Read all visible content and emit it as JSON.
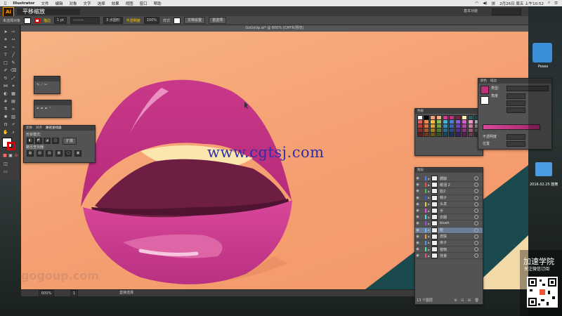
{
  "menubar": {
    "app_name": "Illustrator",
    "items": [
      "文件",
      "编辑",
      "对象",
      "文字",
      "选择",
      "效果",
      "视图",
      "窗口",
      "帮助"
    ],
    "datetime": "2月26日 周五 上午10:52"
  },
  "appbar": {
    "logo": "Ai",
    "workspace": "基本功能",
    "overlay_text": "平移缩放"
  },
  "control_bar": {
    "selection_label": "未选择对象",
    "stroke_label": "描边",
    "stroke_weight": "1 pt",
    "brush_label": "3 点圆形",
    "opacity_label": "不透明度",
    "opacity_value": "100%",
    "style_label": "样式",
    "doc_setup_button": "文档设置",
    "prefs_button": "首选项"
  },
  "document": {
    "tab_title": "GoGoUp.ai* @ 600% (CMYK/预览)"
  },
  "canvas": {
    "watermark": "www.cgtsj.com",
    "brand_watermark": "gogoup.com"
  },
  "status_bar": {
    "zoom": "600%",
    "page": "1",
    "tool_name": "直接选择"
  },
  "pathfinder_panel": {
    "tabs": [
      "变换",
      "对齐",
      "路径查找器"
    ],
    "shape_modes_label": "形状模式:",
    "expand_button": "扩展",
    "pathfinders_label": "路径查找器:"
  },
  "swatches_panel": {
    "title": "色板",
    "colors": [
      [
        "#ffffff",
        "#000000",
        "#f5a072",
        "#f7b384",
        "#d63a8e",
        "#c2307c",
        "#7a1f45",
        "#fff1b5",
        "#2d5b5e",
        "#1d4a4d"
      ],
      [
        "#e85a5a",
        "#f08a4b",
        "#f5c244",
        "#8cc152",
        "#48b0d8",
        "#4a7fd1",
        "#8a5ed6",
        "#d65ec5",
        "#e89cc0",
        "#b0b0b0"
      ],
      [
        "#c23b3b",
        "#d8713a",
        "#d9a62f",
        "#6ea33e",
        "#328fb5",
        "#3664ad",
        "#6b44b5",
        "#b144a4",
        "#c87aa0",
        "#808080"
      ],
      [
        "#8f2a2a",
        "#a3552b",
        "#a47d23",
        "#52792e",
        "#256b87",
        "#284b82",
        "#503388",
        "#84327a",
        "#965a78",
        "#505050"
      ],
      [
        "#5e1c1c",
        "#6d381c",
        "#6d5317",
        "#36511f",
        "#19475a",
        "#1b3257",
        "#35225b",
        "#581f51",
        "#643c50",
        "#303030"
      ]
    ]
  },
  "layers_panel": {
    "title": "图层",
    "count_text": "13 个图层",
    "layers": [
      {
        "name": "腮腺",
        "color": "#4f7cf7",
        "selected": false
      },
      {
        "name": "眼泪 2",
        "color": "#e84f4f",
        "selected": false
      },
      {
        "name": "脸2",
        "color": "#4fc04f",
        "selected": false
      },
      {
        "name": "帽子",
        "color": "#3a5bd6",
        "selected": false
      },
      {
        "name": "头发",
        "color": "#e8d04f",
        "selected": false
      },
      {
        "name": "手",
        "color": "#e84fe0",
        "selected": false
      },
      {
        "name": "衣服",
        "color": "#4fe0e8",
        "selected": false
      },
      {
        "name": "blush",
        "color": "#9a4fe8",
        "selected": false
      },
      {
        "name": "脸",
        "color": "#7fb0ff",
        "selected": true
      },
      {
        "name": "皮肤",
        "color": "#e8a04f",
        "selected": false
      },
      {
        "name": "房子",
        "color": "#4f9ae8",
        "selected": false
      },
      {
        "name": "植物",
        "color": "#4fe8a0",
        "selected": false
      },
      {
        "name": "背景",
        "color": "#e84f7a",
        "selected": false
      }
    ]
  },
  "color_panel": {
    "tabs": [
      "颜色",
      "描边"
    ],
    "type_label": "类型:",
    "angle_label": "角度",
    "opacity_label": "不透明度",
    "location_label": "位置"
  },
  "desktop": {
    "items": [
      {
        "label": "Poses"
      },
      {
        "label": "2016.02.25 鼓舞"
      }
    ]
  },
  "ad": {
    "title": "加速学院",
    "subtitle": "关注微信订阅"
  }
}
